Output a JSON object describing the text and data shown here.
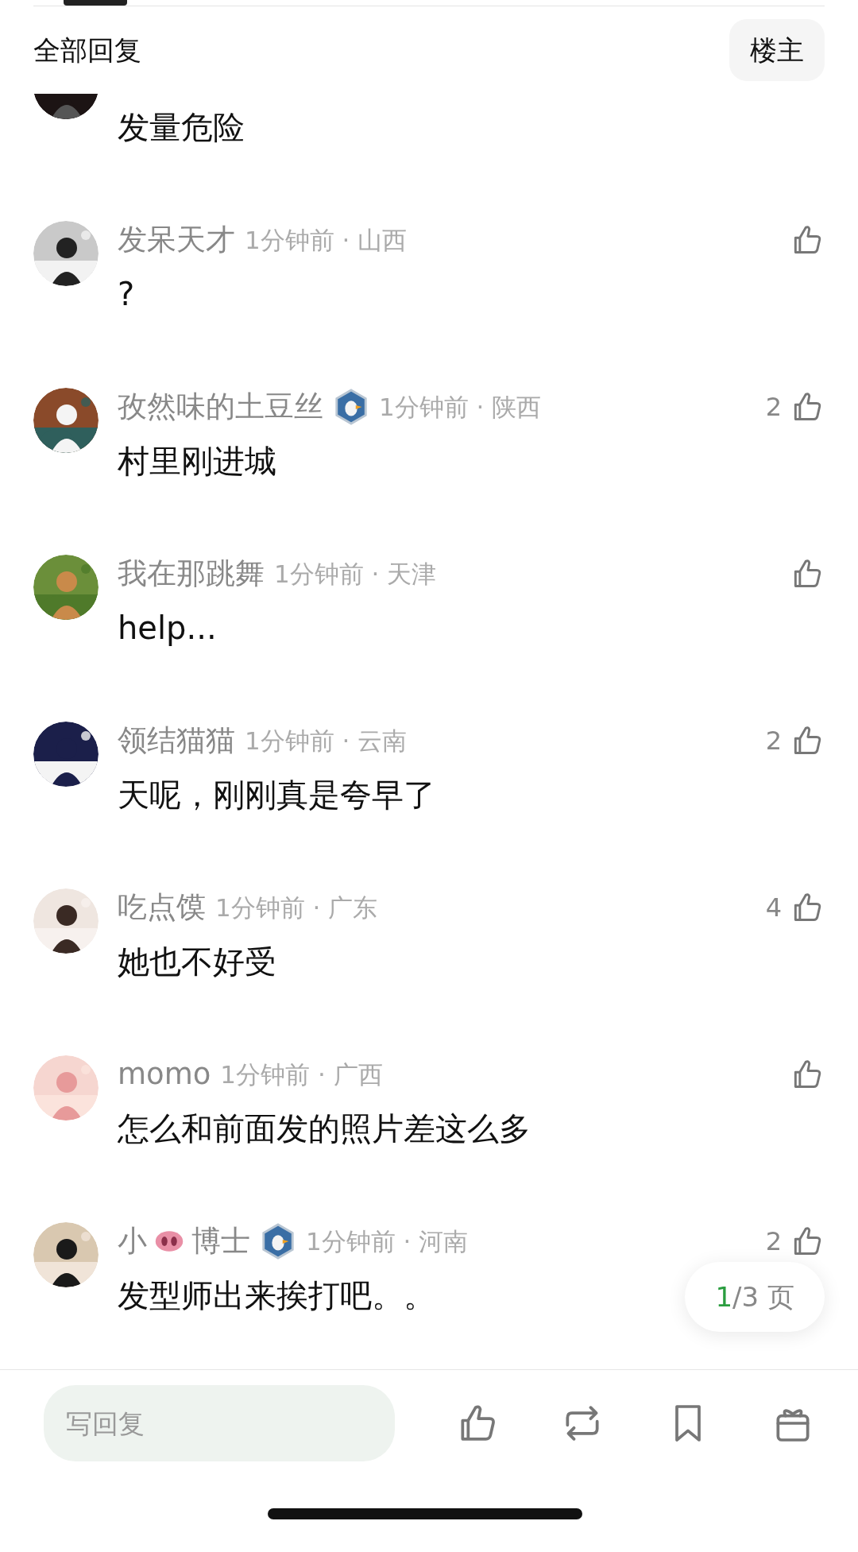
{
  "header": {
    "title": "全部回复",
    "filter_button": "楼主"
  },
  "comments": [
    {
      "partial": true,
      "content": "发量危险"
    },
    {
      "name": "发呆天才",
      "badge": false,
      "meta": "1分钟前 · 山西",
      "content": "?"
    },
    {
      "name": "孜然味的土豆丝",
      "badge": true,
      "meta": "1分钟前 · 陕西",
      "likes": "2",
      "content": "村里刚进城"
    },
    {
      "name": "我在那跳舞",
      "badge": false,
      "meta": "1分钟前 · 天津",
      "content": "help..."
    },
    {
      "name": "领结猫猫",
      "badge": false,
      "meta": "1分钟前 · 云南",
      "likes": "2",
      "content": "天呢，刚刚真是夸早了"
    },
    {
      "name": "吃点馍",
      "badge": false,
      "meta": "1分钟前 · 广东",
      "likes": "4",
      "content": "她也不好受"
    },
    {
      "name": "momo",
      "badge": false,
      "meta": "1分钟前 · 广西",
      "content": "怎么和前面发的照片差这么多"
    },
    {
      "name_parts": [
        {
          "kind": "text",
          "text": "小"
        },
        {
          "kind": "icon"
        },
        {
          "kind": "text",
          "text": "博士"
        }
      ],
      "badge": true,
      "meta": "1分钟前 · 河南",
      "likes": "2",
      "content": "发型师出来挨打吧。。"
    }
  ],
  "page_indicator": {
    "current": "1",
    "rest": "/3 页"
  },
  "reply_bar": {
    "placeholder": "写回复"
  }
}
